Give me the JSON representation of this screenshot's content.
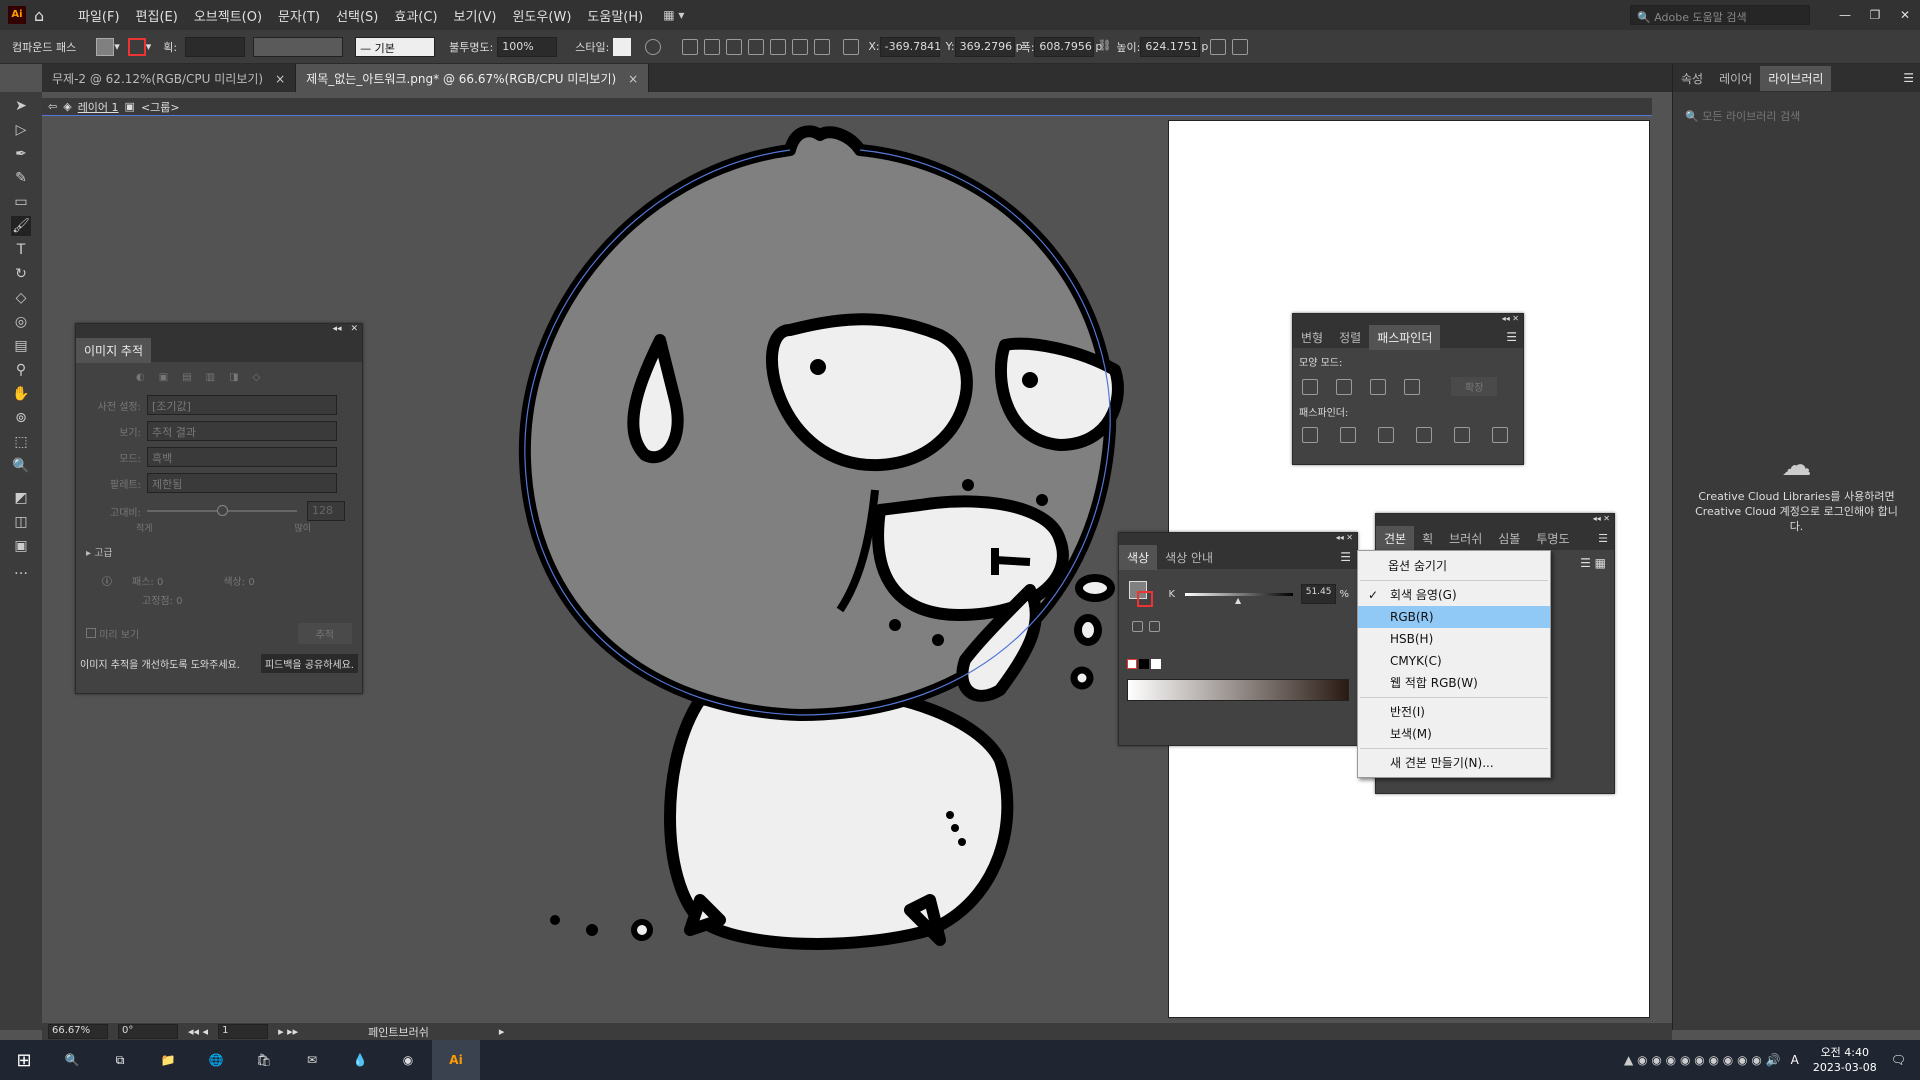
{
  "app": {
    "logo": "Ai"
  },
  "menu": {
    "items": [
      "파일(F)",
      "편집(E)",
      "오브젝트(O)",
      "문자(T)",
      "선택(S)",
      "효과(C)",
      "보기(V)",
      "윈도우(W)",
      "도움말(H)"
    ],
    "search_placeholder": "Adobe 도움말 검색"
  },
  "control": {
    "selection_type": "컴파운드 패스",
    "stroke_label": "획:",
    "stroke_style": "기본",
    "opacity_label": "불투명도:",
    "opacity": "100%",
    "style_label": "스타일:",
    "x_label": "X:",
    "x": "-369.7841",
    "y_label": "Y:",
    "y": "369.2796 p",
    "w_label": "폭:",
    "w": "608.7956 p",
    "h_label": "높이:",
    "h": "624.1751 p"
  },
  "tabs": [
    {
      "label": "무제-2 @ 62.12%(RGB/CPU 미리보기)"
    },
    {
      "label": "제목_없는_아트워크.png* @ 66.67%(RGB/CPU 미리보기)"
    }
  ],
  "tab_close": "×",
  "breadcrumb": {
    "layer": "레이어 1",
    "group": "<그룹>"
  },
  "trace_panel": {
    "title": "이미지 추적",
    "preset_label": "사전 설정:",
    "preset": "[조기값]",
    "view_label": "보기:",
    "view": "추적 결과",
    "mode_label": "모드:",
    "mode": "흑백",
    "palette_label": "팔레트:",
    "palette": "제한됨",
    "threshold_label": "고대비:",
    "threshold": "128",
    "threshold_min": "적게",
    "threshold_max": "많이",
    "advanced": "고급",
    "paths_label": "패스:",
    "paths": "0",
    "colors_label": "색상:",
    "colors": "0",
    "anchors_label": "고정점:",
    "anchors": "0",
    "preview": "미리 보기",
    "trace_button": "추적",
    "feedback_text": "이미지 추적을 개선하도록 도와주세요.",
    "feedback_button": "피드백을 공유하세요."
  },
  "pathfinder_panel": {
    "tabs": [
      "변형",
      "정렬",
      "패스파인더"
    ],
    "shape_modes": "모양 모드:",
    "expand": "확장",
    "pathfinders": "패스파인더:"
  },
  "color_panel": {
    "tabs": [
      "색상",
      "색상 안내"
    ],
    "channel": "K",
    "value": "51.45",
    "unit": "%"
  },
  "swatches_panel": {
    "tabs": [
      "견본",
      "획",
      "브러쉬",
      "심볼",
      "투명도"
    ]
  },
  "context_menu": {
    "items": [
      "옵션 숨기기",
      "회색 음영(G)",
      "RGB(R)",
      "HSB(H)",
      "CMYK(C)",
      "웹 적합 RGB(W)",
      "반전(I)",
      "보색(M)",
      "새 견본 만들기(N)..."
    ],
    "checked": "회색 음영(G)",
    "highlighted": "RGB(R)"
  },
  "right_dock": {
    "tabs": [
      "속성",
      "레이어",
      "라이브러리"
    ],
    "search_placeholder": "모든 라이브러리 검색",
    "message": "Creative Cloud Libraries를 사용하려면 Creative Cloud 계정으로 로그인해야 합니다."
  },
  "status": {
    "zoom": "66.67%",
    "rotation": "0°",
    "artboard": "1",
    "tool": "페인트브러쉬"
  },
  "taskbar": {
    "time": "오전 4:40",
    "date": "2023-03-08",
    "ime": "A"
  },
  "colors": {
    "accent": "#5578d8",
    "highlight": "#90c8f6",
    "artboard": "#ffffff",
    "fill_gray": "#808080",
    "app_logo": "#ff9a00",
    "app_logo_bg": "#330000"
  }
}
